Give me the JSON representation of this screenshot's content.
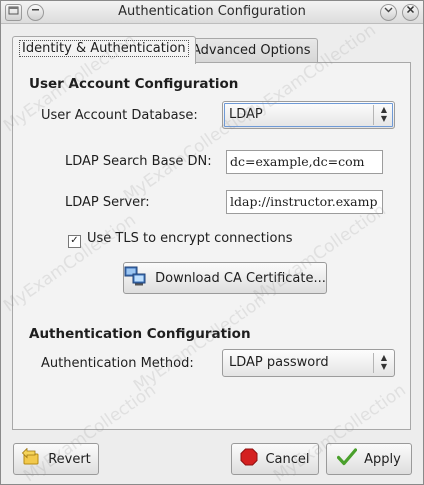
{
  "window": {
    "title": "Authentication Configuration"
  },
  "tabs": [
    {
      "label": "Identity & Authentication",
      "active": true
    },
    {
      "label": "Advanced Options",
      "active": false
    }
  ],
  "user_account": {
    "section_title": "User Account Configuration",
    "database_label": "User Account Database:",
    "database_value": "LDAP",
    "search_base_label": "LDAP Search Base DN:",
    "search_base_value": "dc=example,dc=com",
    "server_label": "LDAP Server:",
    "server_value": "ldap://instructor.examp",
    "tls_label": "Use TLS to encrypt connections",
    "tls_checked": true,
    "download_button_label": "Download CA Certificate..."
  },
  "authentication": {
    "section_title": "Authentication Configuration",
    "method_label": "Authentication Method:",
    "method_value": "LDAP password"
  },
  "footer": {
    "revert_label": "Revert",
    "cancel_label": "Cancel",
    "apply_label": "Apply"
  },
  "watermark": {
    "text": "MyExamCollection"
  },
  "icons": {
    "window_menu": "window-menu-icon",
    "minimize": "minimize-icon",
    "close": "close-icon",
    "download": "network-computers-icon",
    "revert": "revert-arrow-icon",
    "cancel": "stop-icon",
    "apply": "checkmark-icon"
  },
  "colors": {
    "cancel_red": "#d42020",
    "apply_green": "#4aa02c",
    "revert_yellow": "#e8b81e"
  }
}
